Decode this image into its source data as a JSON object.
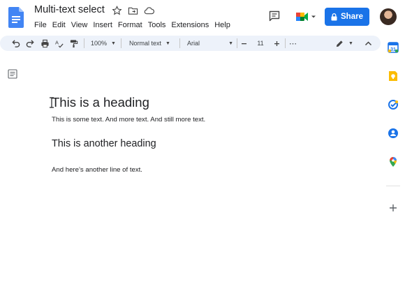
{
  "document": {
    "title": "Multi-text select",
    "menu": [
      "File",
      "Edit",
      "View",
      "Insert",
      "Format",
      "Tools",
      "Extensions",
      "Help"
    ]
  },
  "header": {
    "share_label": "Share",
    "colors": {
      "share_bg": "#1a73e8",
      "docs_blue": "#4285f4"
    }
  },
  "toolbar": {
    "zoom": "100%",
    "style": "Normal text",
    "font": "Arial",
    "font_size": "11",
    "more": "⋯"
  },
  "content": {
    "heading1": "This is a heading",
    "para1": "This is some text. And more text. And still more text.",
    "heading2": "This is another heading",
    "para2": "And here’s another line of text."
  },
  "side_panel": {
    "icons": [
      "calendar-icon",
      "keep-icon",
      "tasks-icon",
      "contacts-icon",
      "maps-icon",
      "add-icon"
    ]
  }
}
